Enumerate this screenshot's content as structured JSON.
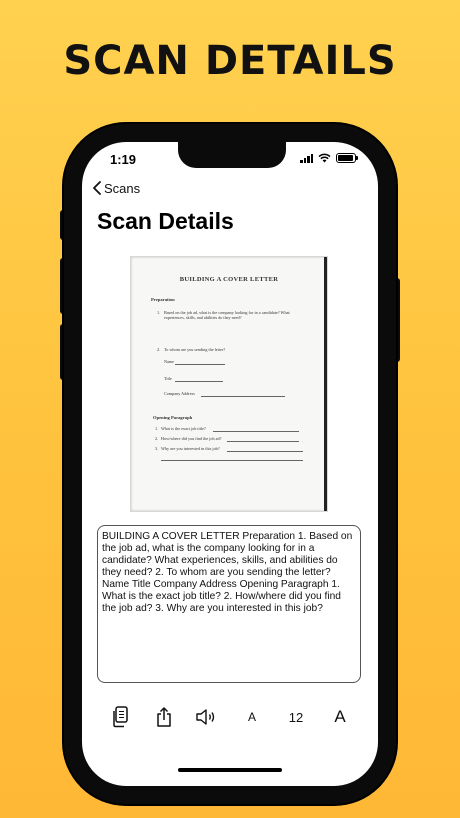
{
  "banner": {
    "title": "SCAN DETAILS"
  },
  "status_bar": {
    "time": "1:19"
  },
  "nav": {
    "back_label": "Scans",
    "title": "Scan Details"
  },
  "scan_image": {
    "title": "BUILDING A COVER LETTER",
    "section1": "Preparation",
    "q1_line1": "Based on the job ad, what is the company looking for in a candidate? What",
    "q1_line2": "experiences, skills, and abilities do they need?",
    "q2": "To whom are you sending the letter?",
    "field_name": "Name",
    "field_title": "Title",
    "field_address": "Company Address",
    "section2": "Opening Paragraph",
    "op1": "What is the exact job title?",
    "op2": "How/where did you find the job ad?",
    "op3": "Why are you interested in this job?"
  },
  "ocr_text": "BUILDING A COVER LETTER Preparation 1. Based on the job ad, what is the company looking for in a candidate? What experiences, skills, and abilities do they need? 2. To whom are you sending the letter? Name Title Company Address Opening Paragraph 1. What is the exact job title? 2. How/where did you find the job ad? 3. Why are you interested in this job?",
  "toolbar": {
    "copy_icon": "copy-icon",
    "share_icon": "share-icon",
    "speaker_icon": "speaker-icon",
    "decrease_font_label": "A",
    "font_size": "12",
    "increase_font_label": "A"
  },
  "colors": {
    "background": "#FFC23D",
    "accent": "#111111"
  }
}
